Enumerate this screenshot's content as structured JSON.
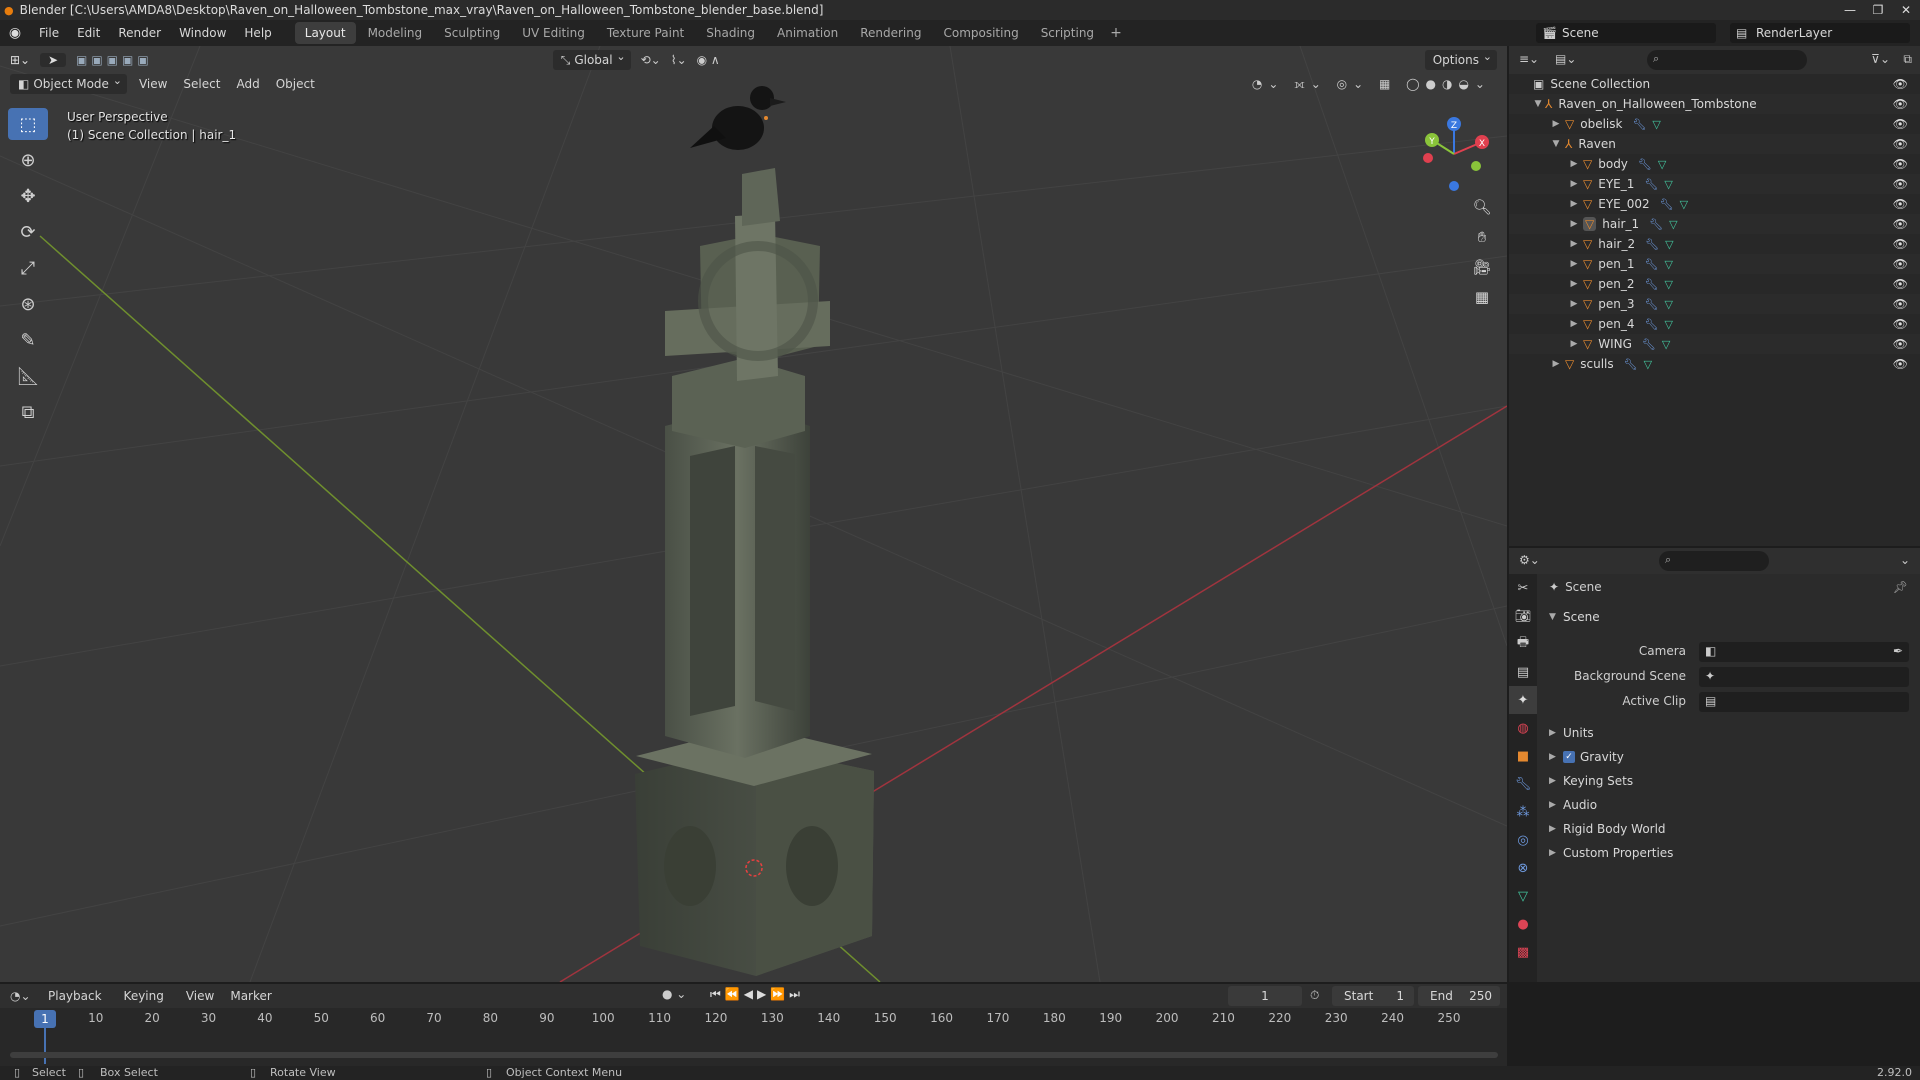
{
  "window": {
    "title": "Blender [C:\\Users\\AMDA8\\Desktop\\Raven_on_Halloween_Tombstone_max_vray\\Raven_on_Halloween_Tombstone_blender_base.blend]"
  },
  "menus": [
    "File",
    "Edit",
    "Render",
    "Window",
    "Help"
  ],
  "workspaces": [
    "Layout",
    "Modeling",
    "Sculpting",
    "UV Editing",
    "Texture Paint",
    "Shading",
    "Animation",
    "Rendering",
    "Compositing",
    "Scripting"
  ],
  "scene_name": "Scene",
  "view_layer": "RenderLayer",
  "viewport": {
    "mode": "Object Mode",
    "menus": [
      "View",
      "Select",
      "Add",
      "Object"
    ],
    "transform_orientation": "Global",
    "options_label": "Options",
    "overlay_line1": "User Perspective",
    "overlay_line2": "(1) Scene Collection | hair_1"
  },
  "outliner": {
    "root": "Scene Collection",
    "collection": "Raven_on_Halloween_Tombstone",
    "items": [
      {
        "name": "obelisk",
        "indent": 1
      },
      {
        "name": "Raven",
        "indent": 1
      },
      {
        "name": "body",
        "indent": 2
      },
      {
        "name": "EYE_1",
        "indent": 2
      },
      {
        "name": "EYE_002",
        "indent": 2
      },
      {
        "name": "hair_1",
        "indent": 2
      },
      {
        "name": "hair_2",
        "indent": 2
      },
      {
        "name": "pen_1",
        "indent": 2
      },
      {
        "name": "pen_2",
        "indent": 2
      },
      {
        "name": "pen_3",
        "indent": 2
      },
      {
        "name": "pen_4",
        "indent": 2
      },
      {
        "name": "WING",
        "indent": 2
      },
      {
        "name": "sculls",
        "indent": 1
      }
    ]
  },
  "properties": {
    "header": "Scene",
    "panel": "Scene",
    "camera_label": "Camera",
    "background_scene_label": "Background Scene",
    "active_clip_label": "Active Clip",
    "panels": [
      "Units",
      "Gravity",
      "Keying Sets",
      "Audio",
      "Rigid Body World",
      "Custom Properties"
    ]
  },
  "timeline": {
    "menus": [
      "Playback",
      "Keying",
      "View",
      "Marker"
    ],
    "current_frame": "1",
    "start_label": "Start",
    "start_value": "1",
    "end_label": "End",
    "end_value": "250",
    "ticks": [
      "10",
      "20",
      "30",
      "40",
      "50",
      "60",
      "70",
      "80",
      "90",
      "100",
      "110",
      "120",
      "130",
      "140",
      "150",
      "160",
      "170",
      "180",
      "190",
      "200",
      "210",
      "220",
      "230",
      "240",
      "250"
    ],
    "playhead_label": "1"
  },
  "status": {
    "select": "Select",
    "box_select": "Box Select",
    "rotate_view": "Rotate View",
    "context_menu": "Object Context Menu",
    "version": "2.92.0"
  },
  "colors": {
    "accent": "#4772b3",
    "object_icon": "#e5892f",
    "modifier_icon": "#6f9be0",
    "mesh_icon": "#43c59e",
    "x_axis": "#e0404f",
    "y_axis": "#8ac43a",
    "z_axis": "#3a78e0"
  }
}
